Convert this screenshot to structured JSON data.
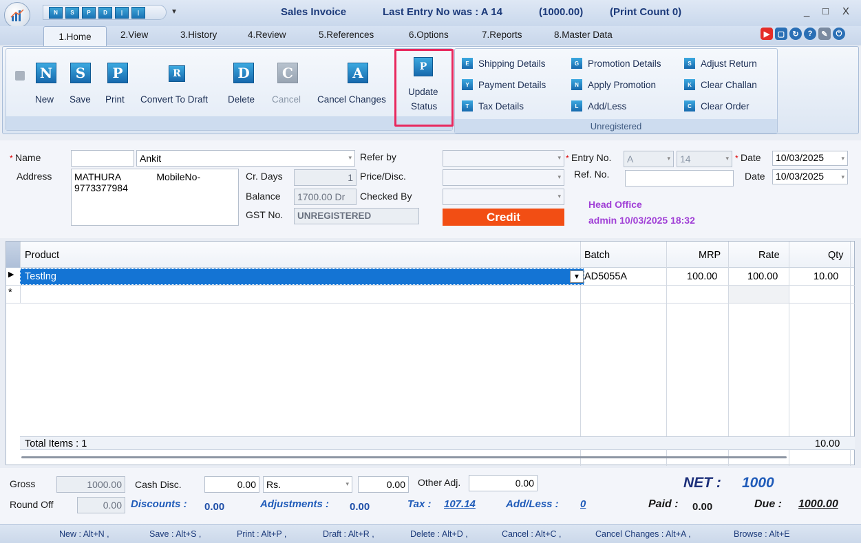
{
  "window": {
    "title": "Sales Invoice",
    "last_entry": "Last Entry No was : A 14",
    "amount": "(1000.00)",
    "print_count": "(Print Count 0)",
    "minimize": "_",
    "maximize": "□",
    "close": "X",
    "qdd": "▾"
  },
  "tabs": [
    "1.Home",
    "2.View",
    "3.History",
    "4.Review",
    "5.References",
    "6.Options",
    "7.Reports",
    "8.Master Data"
  ],
  "ribbon": {
    "buttons": {
      "new": "New",
      "save": "Save",
      "print": "Print",
      "convert_to_draft": "Convert To Draft",
      "delete": "Delete",
      "cancel": "Cancel",
      "cancel_changes": "Cancel Changes",
      "update_status_1": "Update",
      "update_status_2": "Status"
    },
    "links": {
      "shipping_details": "Shipping Details",
      "payment_details": "Payment Details",
      "tax_details": "Tax Details",
      "promotion_details": "Promotion Details",
      "apply_promotion": "Apply Promotion",
      "add_less": "Add/Less",
      "adjust_return": "Adjust Return",
      "clear_challan": "Clear Challan",
      "clear_order": "Clear Order"
    },
    "group_label": "Unregistered"
  },
  "form": {
    "name_label": "Name",
    "name_value": "Ankit",
    "address_label": "Address",
    "address_line1": "MATHURA",
    "address_mobile": "MobileNo-",
    "address_line2": "9773377984",
    "cr_days_label": "Cr. Days",
    "cr_days_value": "1",
    "balance_label": "Balance",
    "balance_value": "1700.00 Dr",
    "gst_label": "GST No.",
    "gst_value": "UNREGISTERED",
    "refer_by_label": "Refer by",
    "price_disc_label": "Price/Disc.",
    "checked_by_label": "Checked By",
    "credit_label": "Credit",
    "entry_no_label": "Entry No.",
    "entry_series": "A",
    "entry_number": "14",
    "ref_no_label": "Ref. No.",
    "date_label": "Date",
    "date1": "10/03/2025",
    "date2": "10/03/2025",
    "head_office": "Head Office",
    "user_time": "admin 10/03/2025 18:32"
  },
  "grid": {
    "columns": [
      "Product",
      "Batch",
      "MRP",
      "Rate",
      "Qty"
    ],
    "rows": [
      {
        "product": "Testlng",
        "batch": "AD5055A",
        "mrp": "100.00",
        "rate": "100.00",
        "qty": "10.00"
      }
    ],
    "new_row_marker": "*",
    "total_items": "Total Items : 1",
    "total_qty": "10.00"
  },
  "totals": {
    "gross_label": "Gross",
    "gross_value": "1000.00",
    "cash_disc_label": "Cash Disc.",
    "cash_disc_value": "0.00",
    "cash_disc_type": "Rs.",
    "cash_disc_amount": "0.00",
    "other_adj_label": "Other Adj.",
    "other_adj_value": "0.00",
    "round_off_label": "Round Off",
    "round_off_value": "0.00",
    "discounts": "Discounts :",
    "discounts_value": "0.00",
    "adjustments": "Adjustments :",
    "adjustments_value": "0.00",
    "tax": "Tax :",
    "tax_value": "107.14",
    "add_less": "Add/Less :",
    "add_less_value": "0",
    "net_label": "NET :",
    "net_value": "1000",
    "paid_label": "Paid :",
    "paid_value": "0.00",
    "due_label": "Due :",
    "due_value": "1000.00"
  },
  "shortcuts": [
    "New : Alt+N ,",
    "Save : Alt+S ,",
    "Print : Alt+P ,",
    "Draft : Alt+R ,",
    "Delete : Alt+D ,",
    "Cancel : Alt+C ,",
    "Cancel Changes : Alt+A ,",
    "Browse : Alt+E"
  ]
}
